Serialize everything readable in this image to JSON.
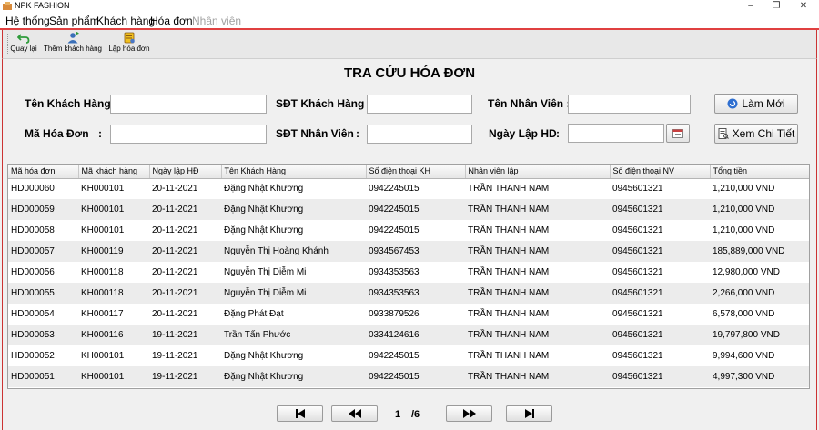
{
  "app": {
    "title": "NPK FASHION",
    "minimize": "–",
    "maximize": "❐",
    "close": "✕"
  },
  "menu": [
    {
      "label": "Hệ thống",
      "enabled": true
    },
    {
      "label": "Sản phẩm",
      "enabled": true
    },
    {
      "label": "Khách hàng",
      "enabled": true
    },
    {
      "label": "Hóa đơn",
      "enabled": true
    },
    {
      "label": "Nhân viên",
      "enabled": false
    }
  ],
  "toolbar": {
    "back_label": "Quay lại",
    "add_customer_label": "Thêm khách hàng",
    "create_invoice_label": "Lập hóa đơn"
  },
  "page": {
    "title": "TRA CỨU HÓA ĐƠN"
  },
  "form": {
    "customer_name_label": "Tên Khách Hàng:",
    "customer_phone_label": "SĐT Khách Hàng :",
    "employee_name_label": "Tên Nhân Viên :",
    "invoice_id_label": "Mã Hóa Đơn",
    "invoice_id_colon": ":",
    "employee_phone_label": "SĐT Nhân Viên",
    "employee_phone_colon": ":",
    "invoice_date_label": "Ngày Lập HD",
    "invoice_date_colon": ":",
    "refresh_button": "Làm Mới",
    "detail_button": "Xem Chi Tiết",
    "customer_name_value": "",
    "customer_phone_value": "",
    "employee_name_value": "",
    "invoice_id_value": "",
    "employee_phone_value": "",
    "invoice_date_value": ""
  },
  "table": {
    "columns": [
      "Mã hóa đơn",
      "Mã khách hàng",
      "Ngày lập HĐ",
      "Tên Khách Hàng",
      "Số điện thoại KH",
      "Nhân viên lập",
      "Số điện thoại NV",
      "Tổng tiền"
    ],
    "rows": [
      [
        "HD000060",
        "KH000101",
        "20-11-2021",
        "Đặng Nhật Khương",
        "0942245015",
        "TRẦN THANH NAM",
        "0945601321",
        "1,210,000 VND"
      ],
      [
        "HD000059",
        "KH000101",
        "20-11-2021",
        "Đặng Nhật Khương",
        "0942245015",
        "TRẦN THANH NAM",
        "0945601321",
        "1,210,000 VND"
      ],
      [
        "HD000058",
        "KH000101",
        "20-11-2021",
        "Đặng Nhật Khương",
        "0942245015",
        "TRẦN THANH NAM",
        "0945601321",
        "1,210,000 VND"
      ],
      [
        "HD000057",
        "KH000119",
        "20-11-2021",
        "Nguyễn Thị Hoàng Khánh",
        "0934567453",
        "TRẦN THANH NAM",
        "0945601321",
        "185,889,000 VND"
      ],
      [
        "HD000056",
        "KH000118",
        "20-11-2021",
        "Nguyễn Thị Diễm Mi",
        "0934353563",
        "TRẦN THANH NAM",
        "0945601321",
        "12,980,000 VND"
      ],
      [
        "HD000055",
        "KH000118",
        "20-11-2021",
        "Nguyễn Thị Diễm Mi",
        "0934353563",
        "TRẦN THANH NAM",
        "0945601321",
        "2,266,000 VND"
      ],
      [
        "HD000054",
        "KH000117",
        "20-11-2021",
        "Đặng Phát Đạt",
        "0933879526",
        "TRẦN THANH NAM",
        "0945601321",
        "6,578,000 VND"
      ],
      [
        "HD000053",
        "KH000116",
        "19-11-2021",
        "Trần Tấn Phước",
        "0334124616",
        "TRẦN THANH NAM",
        "0945601321",
        "19,797,800 VND"
      ],
      [
        "HD000052",
        "KH000101",
        "19-11-2021",
        "Đặng Nhật Khương",
        "0942245015",
        "TRẦN THANH NAM",
        "0945601321",
        "9,994,600 VND"
      ],
      [
        "HD000051",
        "KH000101",
        "19-11-2021",
        "Đặng Nhật Khương",
        "0942245015",
        "TRẦN THANH NAM",
        "0945601321",
        "4,997,300 VND"
      ]
    ]
  },
  "pager": {
    "current_page": "1",
    "total_pages": "/6"
  },
  "colors": {
    "accent_border": "#cc3333",
    "row_alt": "#ececec"
  },
  "icons": {
    "back": "undo-arrow-icon",
    "add_customer": "add-user-icon",
    "create_invoice": "invoice-icon",
    "refresh": "refresh-icon",
    "detail": "detail-document-icon",
    "calendar": "calendar-icon",
    "first": "first-page-icon",
    "prev": "previous-page-icon",
    "next": "next-page-icon",
    "last": "last-page-icon"
  }
}
